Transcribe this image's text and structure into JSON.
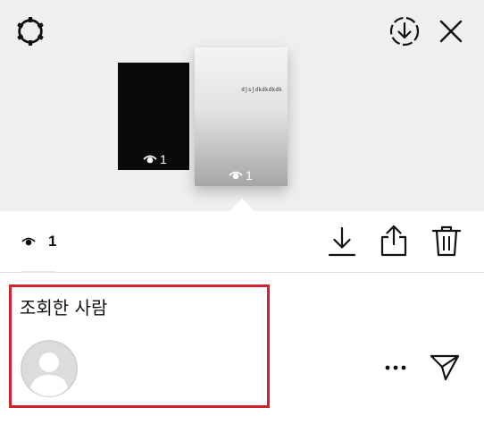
{
  "header": {
    "settings_icon": "gear-icon",
    "download_icon": "download-circle-icon",
    "close_icon": "close-icon"
  },
  "stories": [
    {
      "theme": "black",
      "views": "1"
    },
    {
      "theme": "gray-gradient",
      "text": "djsjdkdkdkdk",
      "views": "1"
    }
  ],
  "toolbar": {
    "views": "1",
    "download_icon": "download-icon",
    "share_icon": "share-icon",
    "delete_icon": "trash-icon"
  },
  "viewers": {
    "title": "조회한 사람",
    "items": [
      {
        "avatar": "default-avatar",
        "more_icon": "more-icon",
        "send_icon": "send-icon"
      }
    ]
  },
  "colors": {
    "top_background": "#efefef",
    "highlight_border": "#d1242f"
  }
}
